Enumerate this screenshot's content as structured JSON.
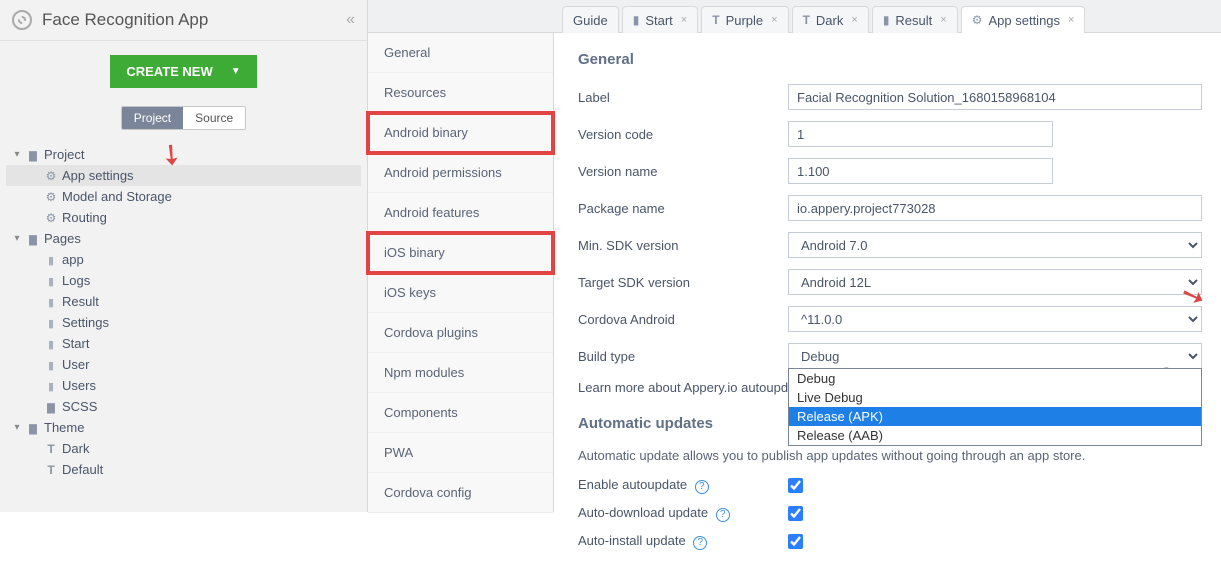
{
  "app_title": "Face Recognition App",
  "create_btn": "CREATE NEW",
  "segments": {
    "project": "Project",
    "source": "Source"
  },
  "tree": {
    "project": "Project",
    "app_settings": "App settings",
    "model_storage": "Model and Storage",
    "routing": "Routing",
    "pages": "Pages",
    "app": "app",
    "logs": "Logs",
    "result": "Result",
    "settings": "Settings",
    "start": "Start",
    "user": "User",
    "users": "Users",
    "scss": "SCSS",
    "theme": "Theme",
    "dark": "Dark",
    "default": "Default"
  },
  "settings_nav": {
    "general": "General",
    "resources": "Resources",
    "android_binary": "Android binary",
    "android_permissions": "Android permissions",
    "android_features": "Android features",
    "ios_binary": "iOS binary",
    "ios_keys": "iOS keys",
    "cordova_plugins": "Cordova plugins",
    "npm_modules": "Npm modules",
    "components": "Components",
    "pwa": "PWA",
    "cordova_config": "Cordova config"
  },
  "tabs": {
    "guide": "Guide",
    "start": "Start",
    "purple": "Purple",
    "dark": "Dark",
    "result": "Result",
    "app_settings": "App settings"
  },
  "form": {
    "section_general": "General",
    "label": {
      "lbl": "Label",
      "val": "Facial Recognition Solution_1680158968104"
    },
    "version_code": {
      "lbl": "Version code",
      "val": "1"
    },
    "version_name": {
      "lbl": "Version name",
      "val": "1.100"
    },
    "package_name": {
      "lbl": "Package name",
      "val": "io.appery.project773028"
    },
    "min_sdk": {
      "lbl": "Min. SDK version",
      "val": "Android 7.0"
    },
    "target_sdk": {
      "lbl": "Target SDK version",
      "val": "Android 12L"
    },
    "cordova_android": {
      "lbl": "Cordova Android",
      "val": "^11.0.0"
    },
    "build_type": {
      "lbl": "Build type",
      "val": "Debug"
    },
    "learn_more": "Learn more about Appery.io autoupda",
    "section_auto": "Automatic updates",
    "auto_desc": "Automatic update allows you to publish app updates without going through an app store.",
    "enable_auto": "Enable autoupdate",
    "auto_download": "Auto-download update",
    "auto_install": "Auto-install update"
  },
  "build_options": {
    "debug": "Debug",
    "live_debug": "Live Debug",
    "release_apk": "Release (APK)",
    "release_aab": "Release (AAB)"
  }
}
